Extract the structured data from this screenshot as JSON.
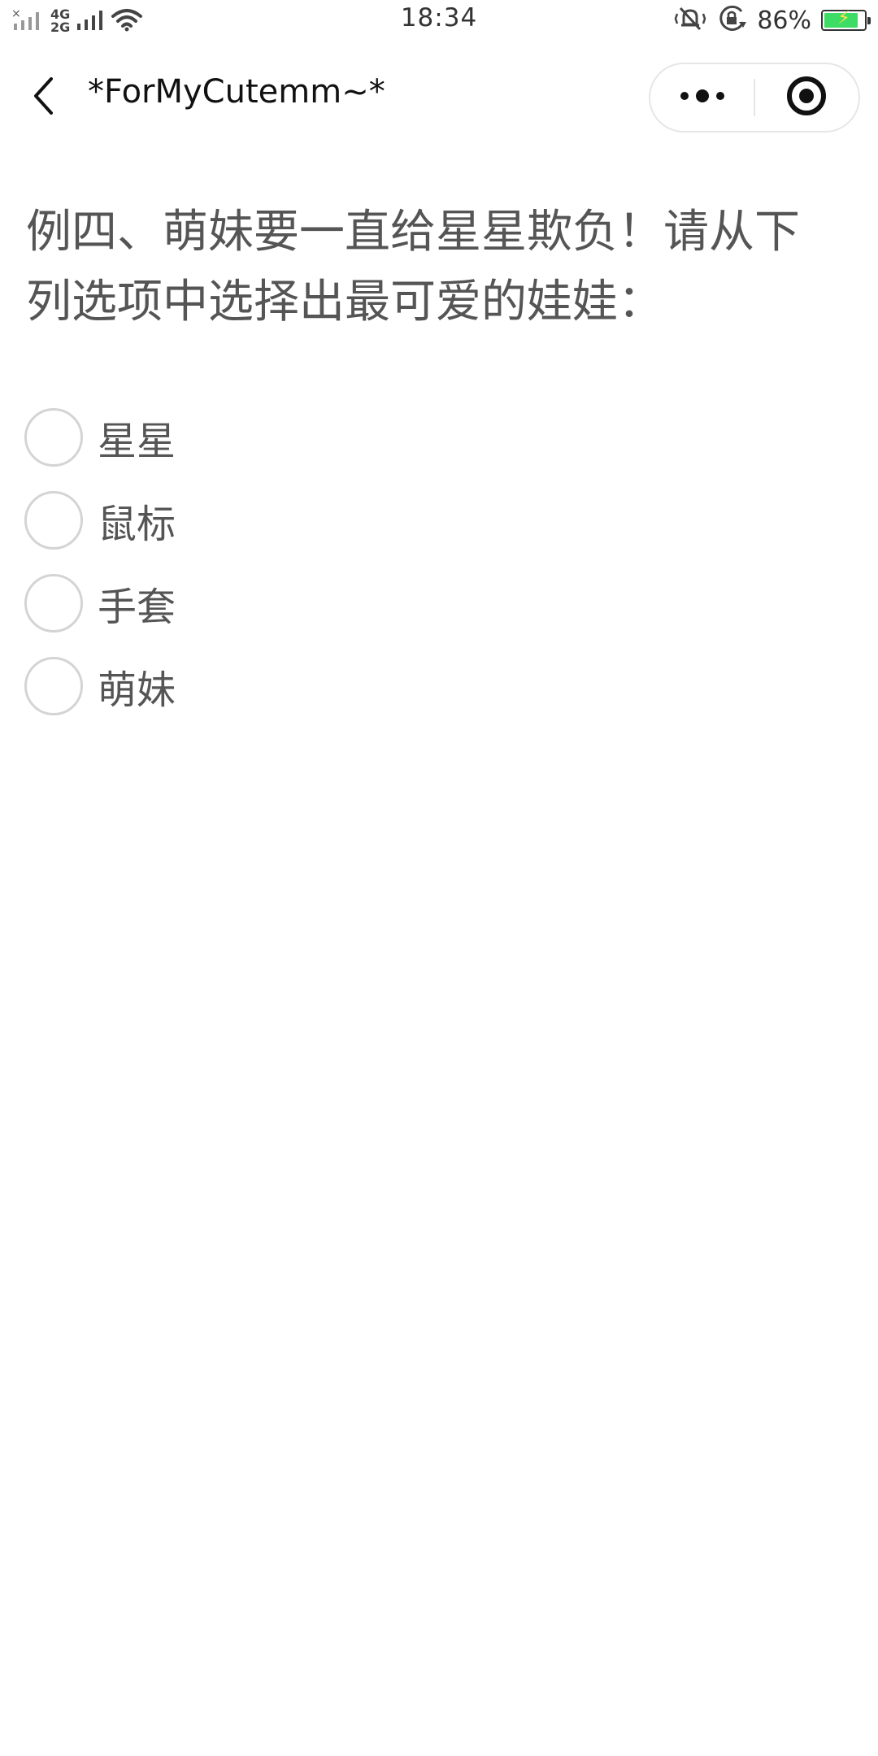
{
  "status_bar": {
    "time": "18:34",
    "battery_percent": "86%",
    "battery_level": 0.86,
    "network_4g": "4G",
    "network_2g": "2G",
    "icons": [
      "signal-off-icon",
      "signal-icon",
      "wifi-icon",
      "vibrate-icon",
      "rotation-lock-icon",
      "battery-charging-icon"
    ]
  },
  "nav": {
    "title": "*ForMyCutemm~*",
    "icons": [
      "back-arrow-icon",
      "more-dots-icon",
      "close-target-icon"
    ]
  },
  "question": {
    "text": "例四、萌妹要一直给星星欺负！请从下列选项中选择出最可爱的娃娃："
  },
  "options": [
    {
      "label": "星星"
    },
    {
      "label": "鼠标"
    },
    {
      "label": "手套"
    },
    {
      "label": "萌妹"
    }
  ],
  "colors": {
    "text_primary": "#555555",
    "title": "#111111",
    "radio_border": "#d4d4d4",
    "battery_fill": "#3ddc64"
  }
}
